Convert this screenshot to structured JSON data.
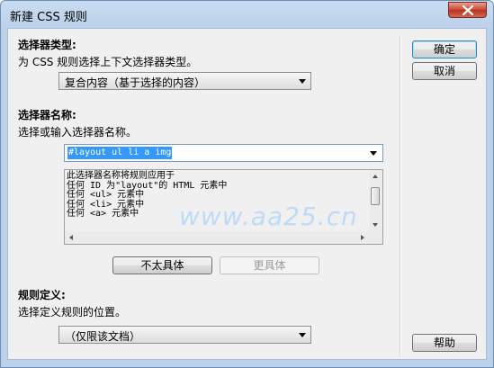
{
  "window": {
    "title": "新建 CSS 规则"
  },
  "selector_type": {
    "heading": "选择器类型:",
    "description": "为 CSS 规则选择上下文选择器类型。",
    "selected": "复合内容（基于选择的内容）"
  },
  "selector_name": {
    "heading": "选择器名称:",
    "description": "选择或输入选择器名称。",
    "value": "#layout ul li a img",
    "details": [
      "此选择器名称将规则应用于",
      "任何 ID 为\"layout\"的 HTML 元素中",
      "任何 <ul> 元素中",
      "任何 <li> 元素中",
      "任何 <a> 元素中"
    ],
    "less_specific_label": "不太具体",
    "more_specific_label": "更具体"
  },
  "rule_definition": {
    "heading": "规则定义:",
    "description": "选择定义规则的位置。",
    "selected": "（仅限该文档）"
  },
  "buttons": {
    "ok": "确定",
    "cancel": "取消",
    "help": "帮助"
  },
  "watermark": "www.aa25.cn"
}
